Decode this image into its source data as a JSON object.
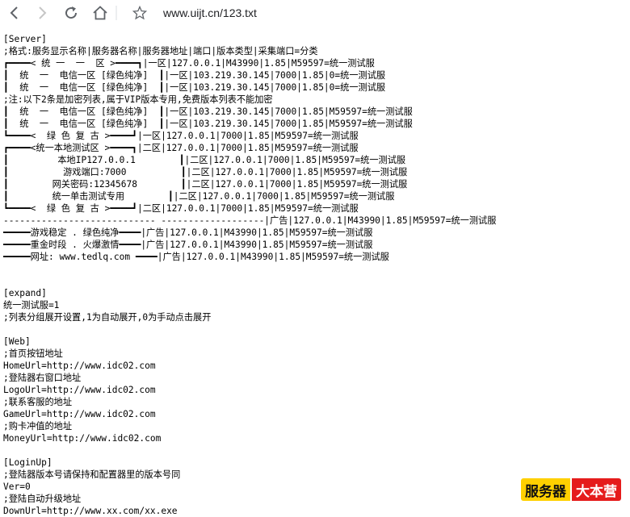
{
  "browser": {
    "url": "www.uijt.cn/123.txt"
  },
  "file_lines": [
    "[Server]",
    ";格式:服务显示名称|服务器名称|服务器地址|端口|版本类型|采集端口=分类",
    "┏━━━━< 统 一  一  区 >━━━━┓|一区|127.0.0.1|M43990|1.85|M59597=统一测试服",
    "┃  统  一  电信一区 [绿色纯净]  ┃|一区|103.219.30.145|7000|1.85|0=统一测试服",
    "┃  统  一  电信一区 [绿色纯净]  ┃|一区|103.219.30.145|7000|1.85|0=统一测试服",
    ";注:以下2条是加密列表,属于VIP版本专用,免费版本列表不能加密",
    "┃  统  一  电信一区 [绿色纯净]  ┃|一区|103.219.30.145|7000|1.85|M59597=统一测试服",
    "┃  统  一  电信一区 [绿色纯净]  ┃|一区|103.219.30.145|7000|1.85|M59597=统一测试服",
    "┗━━━━<  绿 色 复 古 >━━━━┛|一区|127.0.0.1|7000|1.85|M59597=统一测试服",
    "┏━━━━<统一本地测试区 >━━━━┓|二区|127.0.0.1|7000|1.85|M59597=统一测试服",
    "┃         本地IP127.0.0.1        ┃|二区|127.0.0.1|7000|1.85|M59597=统一测试服",
    "┃          游戏端口:7000          ┃|二区|127.0.0.1|7000|1.85|M59597=统一测试服",
    "┃        网关密码:12345678        ┃|二区|127.0.0.1|7000|1.85|M59597=统一测试服",
    "┃        统一单击测试专用        ┃|二区|127.0.0.1|7000|1.85|M59597=统一测试服",
    "┗━━━━<  绿 色 复 古 >━━━━┛|二区|127.0.0.1|7000|1.85|M59597=统一测试服",
    "---------------------------- -------------------|广告|127.0.0.1|M43990|1.85|M59597=统一测试服",
    "━━━━━游戏稳定 . 绿色纯净━━━━|广告|127.0.0.1|M43990|1.85|M59597=统一测试服",
    "━━━━━重金时段 . 火爆激情━━━━|广告|127.0.0.1|M43990|1.85|M59597=统一测试服",
    "━━━━━网址: www.tedlq.com ━━━━|广告|127.0.0.1|M43990|1.85|M59597=统一测试服",
    "",
    "",
    "[expand]",
    "统一测试服=1",
    ";列表分组展开设置,1为自动展开,0为手动点击展开",
    "",
    "[Web]",
    ";首页按钮地址",
    "HomeUrl=http://www.idc02.com",
    ";登陆器右窗口地址",
    "LogoUrl=http://www.idc02.com",
    ";联系客服的地址",
    "GameUrl=http://www.idc02.com",
    ";购卡冲值的地址",
    "MoneyUrl=http://www.idc02.com",
    "",
    "[LoginUp]",
    ";登陆器版本号请保持和配置器里的版本号同",
    "Ver=0",
    ";登陆自动升级地址",
    "DownUrl=http://www.xx.com/xx.exe"
  ],
  "watermark": {
    "left_text": "服务器",
    "right_text": "大本营",
    "left_color": "#ffd000",
    "right_color": "#e51c1c"
  },
  "icons": [
    "back-icon",
    "forward-icon",
    "reload-icon",
    "home-icon",
    "star-icon"
  ]
}
